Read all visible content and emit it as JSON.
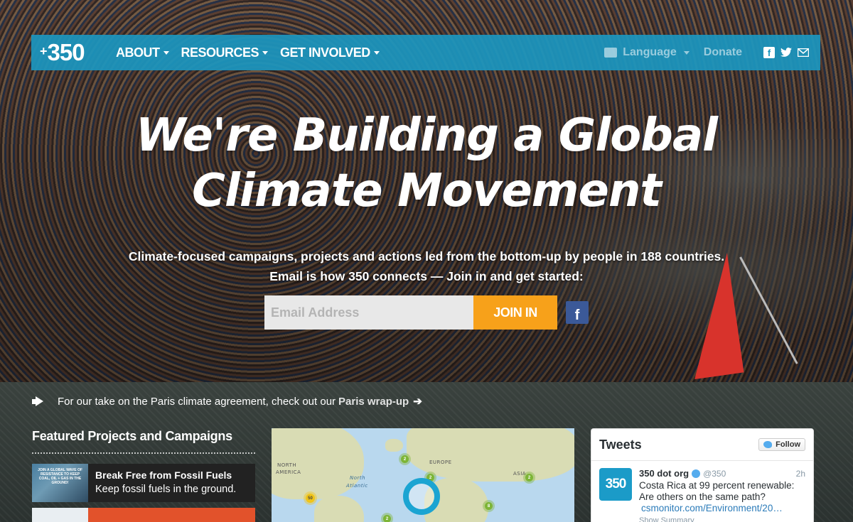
{
  "nav": {
    "logo": "350",
    "items": [
      {
        "label": "About"
      },
      {
        "label": "Resources"
      },
      {
        "label": "Get Involved"
      }
    ],
    "language_label": "Language",
    "donate_label": "Donate",
    "social_icons": [
      "facebook-icon",
      "twitter-icon",
      "email-icon"
    ],
    "bar_color": "#1c96be"
  },
  "hero": {
    "headline_line1": "We're Building a Global",
    "headline_line2": "Climate Movement",
    "sub_line1": "Climate-focused campaigns, projects and actions led from the bottom-up by people in 188 countries.",
    "sub_line2": "Email is how 350 connects — Join in and get started:",
    "email_placeholder": "Email Address",
    "join_label": "JOIN IN",
    "join_color": "#f7a11a"
  },
  "notice": {
    "text": "For our take on the Paris climate agreement, check out our",
    "link": "Paris wrap-up",
    "arrow": "➔"
  },
  "featured": {
    "heading": "Featured Projects and Campaigns",
    "items": [
      {
        "title": "Break Free from Fossil Fuels",
        "subtitle": "Keep fossil fuels in the ground.",
        "thumb_text": "JOIN A GLOBAL WAVE OF RESISTANCE TO KEEP COAL, OIL + GAS IN THE GROUND!"
      }
    ]
  },
  "map": {
    "labels": [
      "NORTH",
      "AMERICA",
      "North",
      "Atlantic",
      "EUROPE",
      "ASIA"
    ],
    "clusters": [
      "2",
      "50",
      "2",
      "2",
      "8",
      "2"
    ]
  },
  "tweets": {
    "title": "Tweets",
    "follow_label": "Follow",
    "avatar_text": "350",
    "name": "350 dot org",
    "handle": "@350",
    "time": "2h",
    "text": "Costa Rica at 99 percent renewable: Are others on the same path?",
    "link": "csmonitor.com/Environment/20…",
    "summary": "Show Summary"
  }
}
